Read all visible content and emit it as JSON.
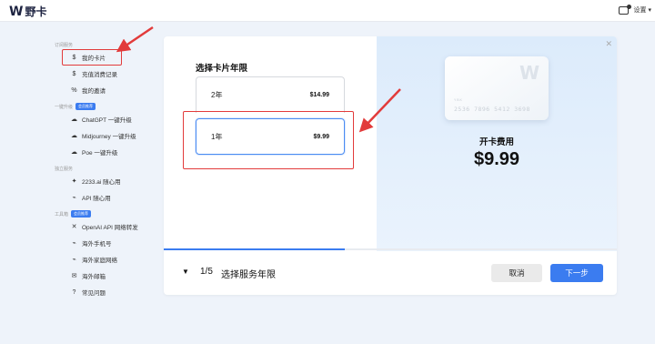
{
  "app": {
    "logo_mark": "W",
    "name": "野卡"
  },
  "topbar": {
    "settings_label": "设置"
  },
  "sidebar": {
    "sections": [
      {
        "title": "订阅服务",
        "tag": "",
        "items": [
          {
            "label": "我的卡片",
            "icon": "dollar-icon"
          },
          {
            "label": "充值消费记录",
            "icon": "dollar-icon"
          },
          {
            "label": "我的邀请",
            "icon": "percent-icon"
          }
        ]
      },
      {
        "title": "一键升级",
        "tag": "会员推荐",
        "items": [
          {
            "label": "ChatGPT 一键升级",
            "icon": "cloud-icon"
          },
          {
            "label": "Midjourney 一键升级",
            "icon": "cloud-icon"
          },
          {
            "label": "Poe 一键升级",
            "icon": "cloud-icon"
          }
        ]
      },
      {
        "title": "独立服务",
        "tag": "",
        "items": [
          {
            "label": "2233.ai 随心用",
            "icon": "sparkle-icon"
          },
          {
            "label": "API 随心用",
            "icon": "link-icon"
          }
        ]
      },
      {
        "title": "工具箱",
        "tag": "会员推荐",
        "items": [
          {
            "label": "OpenAI API 网络转发",
            "icon": "shuffle-icon"
          },
          {
            "label": "海外手机号",
            "icon": "link-icon"
          },
          {
            "label": "海外家庭网络",
            "icon": "link-icon"
          },
          {
            "label": "海外邮箱",
            "icon": "mail-icon"
          },
          {
            "label": "常见问题",
            "icon": "help-icon"
          }
        ]
      }
    ]
  },
  "main": {
    "select_title": "选择卡片年限",
    "options": [
      {
        "years": "2年",
        "price": "$14.99"
      },
      {
        "years": "1年",
        "price": "$9.99"
      }
    ],
    "card": {
      "logo": "W",
      "label": "Y B K",
      "number": "2536 7896 5412 3698"
    },
    "fee_label": "开卡费用",
    "fee_value": "$9.99",
    "progress": 0.4,
    "step_number": "1/5",
    "step_title": "选择服务年限",
    "cancel_label": "取消",
    "next_label": "下一步"
  },
  "colors": {
    "accent": "#3b7cf0",
    "annotation": "#e23b3b"
  }
}
